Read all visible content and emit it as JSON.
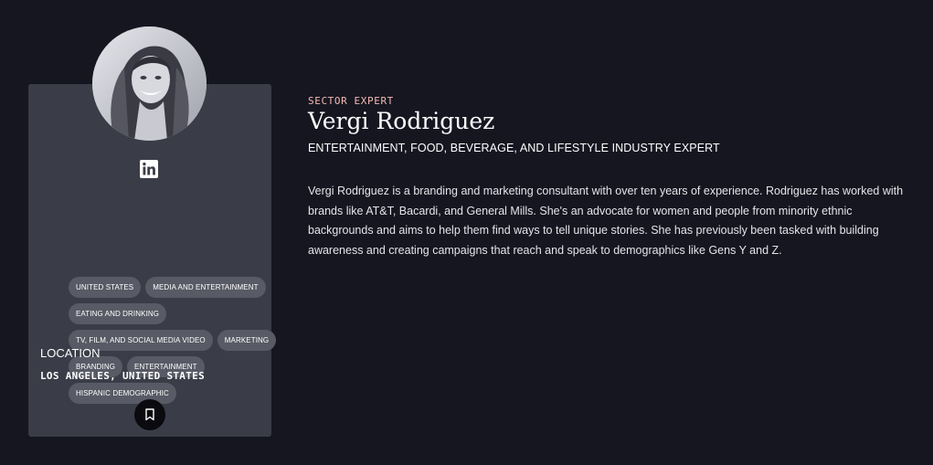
{
  "profile": {
    "kicker": "SECTOR EXPERT",
    "name": "Vergi Rodriguez",
    "subtitle": "ENTERTAINMENT, FOOD, BEVERAGE, AND LIFESTYLE INDUSTRY EXPERT",
    "bio": "Vergi Rodriguez is a branding and marketing consultant with over ten years of experience. Rodriguez has worked with brands like AT&T, Bacardi, and General Mills. She's an advocate for women and people from minority ethnic backgrounds and aims to help them find ways to tell unique stories. She has previously been tasked with building awareness and creating campaigns that reach and speak to demographics like Gens Y and Z."
  },
  "card": {
    "avatar_icon": "profile-photo",
    "social_icon": "linkedin-icon",
    "tags": [
      "UNITED STATES",
      "MEDIA AND ENTERTAINMENT",
      "EATING AND DRINKING",
      "TV, FILM, AND SOCIAL MEDIA VIDEO",
      "MARKETING",
      "BRANDING",
      "ENTERTAINMENT",
      "HISPANIC DEMOGRAPHIC"
    ],
    "location_label": "LOCATION",
    "location_value": "LOS ANGELES, UNITED STATES",
    "bookmark_icon": "bookmark-icon"
  },
  "colors": {
    "background": "#161621",
    "card": "#3a3c47",
    "tag": "#585a65",
    "kicker": "#f2b9b0"
  }
}
